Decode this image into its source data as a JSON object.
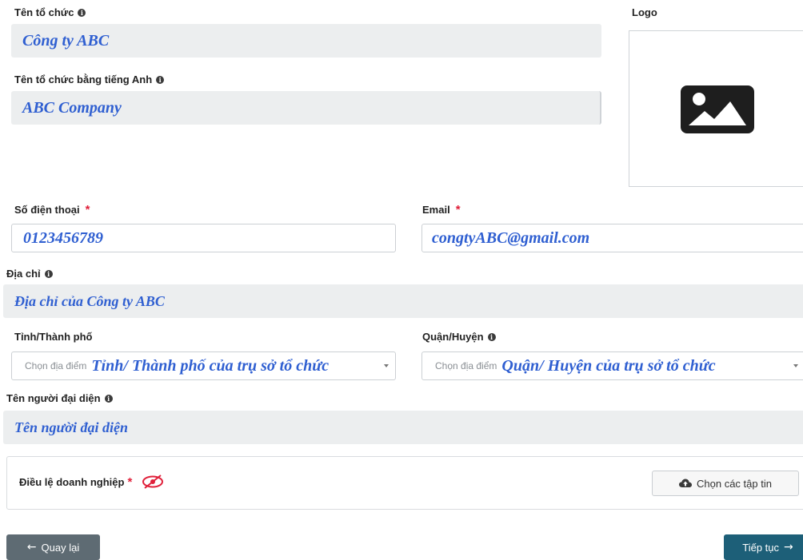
{
  "org_name": {
    "label": "Tên tổ chức",
    "value": "Công ty ABC"
  },
  "org_name_en": {
    "label": "Tên tổ chức bằng tiếng Anh",
    "value": "ABC Company"
  },
  "logo": {
    "label": "Logo",
    "icon": "image-icon"
  },
  "phone": {
    "label": "Số điện thoại",
    "required": "*",
    "value": "0123456789"
  },
  "email": {
    "label": "Email",
    "required": "*",
    "value": "congtyABC@gmail.com"
  },
  "address": {
    "label": "Địa chỉ",
    "value": "Địa chỉ của Công ty ABC"
  },
  "province": {
    "label": "Tỉnh/Thành phố",
    "placeholder": "Chọn địa điểm",
    "annotation": "Tỉnh/ Thành phố của trụ sở tổ chức"
  },
  "district": {
    "label": "Quận/Huyện",
    "placeholder": "Chọn địa điểm",
    "annotation": "Quận/ Huyện của trụ sở tổ chức"
  },
  "representative": {
    "label": "Tên người đại diện",
    "value": "Tên người đại diện"
  },
  "charter": {
    "label": "Điều lệ doanh nghiệp",
    "required": "*",
    "upload_button": "Chọn các tập tin"
  },
  "footer": {
    "back_button": "Quay lại",
    "next_button": "Tiếp tục"
  },
  "colors": {
    "readonly_bg": "#eceeef",
    "handwritten_blue": "#2f5fd1",
    "required_red": "#e0203a",
    "primary": "#1d5f78",
    "back": "#5e6b73"
  }
}
